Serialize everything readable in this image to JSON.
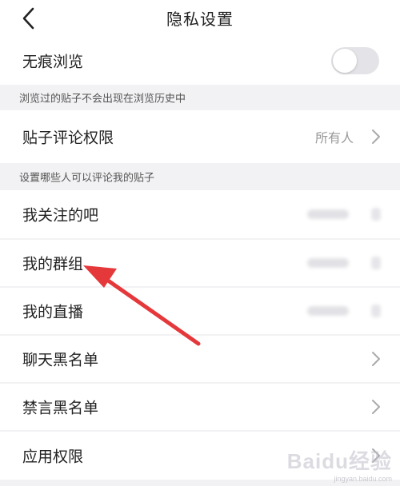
{
  "header": {
    "title": "隐私设置",
    "back_icon": "chevron-left-icon"
  },
  "incognito": {
    "label": "无痕浏览",
    "enabled": false
  },
  "hints": {
    "incognito": "浏览过的贴子不会出现在浏览历史中",
    "comment": "设置哪些人可以评论我的贴子"
  },
  "comment_permission": {
    "label": "贴子评论权限",
    "value": "所有人"
  },
  "items": [
    {
      "label": "我关注的吧"
    },
    {
      "label": "我的群组"
    },
    {
      "label": "我的直播"
    },
    {
      "label": "聊天黑名单"
    },
    {
      "label": "禁言黑名单"
    },
    {
      "label": "应用权限"
    }
  ],
  "watermark": {
    "main": "Baidu经验",
    "sub": "jingyan.baidu.com"
  },
  "colors": {
    "arrow": "#e5383b",
    "toggle_off": "#e4e4e8",
    "hint_text": "#555555"
  }
}
